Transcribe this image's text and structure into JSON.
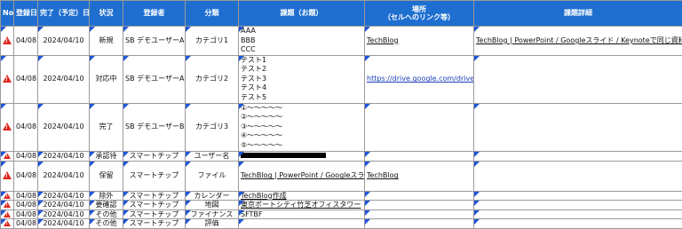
{
  "headers": {
    "no": "No",
    "reg_date": "登録日",
    "due": "完了（予定）日",
    "status": "状況",
    "registrant": "登録者",
    "category": "分類",
    "topic": "課題（お題）",
    "place": "場所\n（セルへのリンク等）",
    "detail": "課題詳細"
  },
  "rows": [
    {
      "reg": "04/08",
      "due": "2024/04/10",
      "status": "新規",
      "who": "SB デモユーザーA",
      "cat": "カテゴリ1",
      "topic_lines": [
        "AAA",
        "BBB",
        "CCC"
      ],
      "place": "TechBlog",
      "detail": "TechBlog | PowerPoint / Googleスライド / Keynoteで同じ資料を開いて互換性を検証してみた"
    },
    {
      "reg": "04/08",
      "due": "2024/04/10",
      "status": "対応中",
      "who": "SB デモユーザーA",
      "cat": "カテゴリ2",
      "topic_lines": [
        "テスト1",
        "テスト2",
        "テスト3",
        "テスト4",
        "テスト5"
      ],
      "place": "https://drive.google.com/drive/",
      "detail": ""
    },
    {
      "reg": "04/08",
      "due": "2024/04/10",
      "status": "完了",
      "who": "SB デモユーザーB",
      "cat": "カテゴリ3",
      "topic_lines": [
        "①〜〜〜〜〜",
        "②〜〜〜〜〜",
        "③〜〜〜〜〜",
        "④〜〜〜〜〜",
        "⑤〜〜〜〜〜"
      ],
      "place": "",
      "detail": ""
    },
    {
      "reg": "04/08",
      "due": "2024/04/10",
      "status": "承認待",
      "who": "スマートチップ",
      "cat": "ユーザー名",
      "topic_lines": [],
      "place": "",
      "detail": ""
    },
    {
      "reg": "04/08",
      "due": "2024/04/10",
      "status": "保留",
      "who": "スマートチップ",
      "cat": "ファイル",
      "topic_lines": [
        "TechBlog | PowerPoint / Googleスライド / Keynoteで同じ資料を開いて互換性を検証してみた"
      ],
      "place": "TechBlog",
      "detail": ""
    },
    {
      "reg": "04/08",
      "due": "2024/04/10",
      "status": "除外",
      "who": "スマートチップ",
      "cat": "カレンダー",
      "topic_lines": [
        "TechBlog作成"
      ],
      "place": "",
      "detail": ""
    },
    {
      "reg": "04/08",
      "due": "2024/04/10",
      "status": "要確認",
      "who": "スマートチップ",
      "cat": "地図",
      "topic_lines": [
        "東京ポートシティ竹芝オフィスタワー"
      ],
      "place": "",
      "detail": ""
    },
    {
      "reg": "04/08",
      "due": "2024/04/10",
      "status": "その他",
      "who": "スマートチップ",
      "cat": "ファイナンス",
      "topic_lines": [
        "SFTBF"
      ],
      "place": "",
      "detail": ""
    },
    {
      "reg": "04/08",
      "due": "2024/04/10",
      "status": "その他",
      "who": "スマートチップ",
      "cat": "評価",
      "topic_lines": [],
      "place": "",
      "detail": ""
    }
  ],
  "colors": {
    "header_bg": "#1f6fd0",
    "marker": "#1f56d9",
    "warning": "#e0251b"
  }
}
